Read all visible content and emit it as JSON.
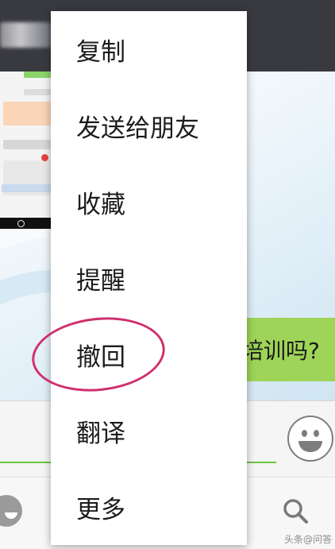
{
  "menu": {
    "items": [
      {
        "label": "复制"
      },
      {
        "label": "发送给朋友"
      },
      {
        "label": "收藏"
      },
      {
        "label": "提醒"
      },
      {
        "label": "撤回"
      },
      {
        "label": "翻译"
      },
      {
        "label": "更多"
      }
    ],
    "highlighted_item": "撤回",
    "highlight_color": "#d0306e"
  },
  "chat": {
    "outgoing_message_partial": "培训吗?",
    "bubble_color": "#9ed457"
  },
  "input": {
    "accent_color": "#6ec244"
  },
  "icons": {
    "emoji": "smiley-icon",
    "search": "search-icon",
    "wink": "wink-emoji-icon"
  },
  "watermark": "头条@问答"
}
